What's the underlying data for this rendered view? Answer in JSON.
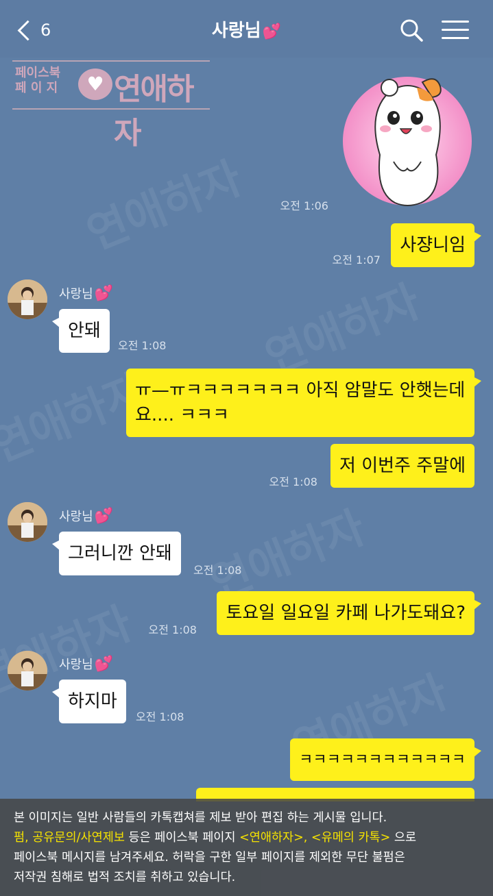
{
  "header": {
    "back_count": "6",
    "title": "사랑님"
  },
  "watermark": {
    "page_label": "페이스북 페이지",
    "page_label_line1": "페이스북",
    "page_label_line2": "페 이 지",
    "name": "연애하자"
  },
  "messages": [
    {
      "side": "mine",
      "type": "emoticon",
      "time": "오전 1:06"
    },
    {
      "side": "mine",
      "text": "사쟝니임",
      "time": "오전 1:07"
    },
    {
      "side": "theirs",
      "sender": "사랑님",
      "text": "안돼",
      "time": "오전 1:08"
    },
    {
      "side": "mine",
      "text": "ㅠ—ㅠㅋㅋㅋㅋㅋㅋㅋ 아직 암말도 안햇는데요.... ㅋㅋㅋ"
    },
    {
      "side": "mine",
      "text": "저 이번주 주말에",
      "time": "오전 1:08"
    },
    {
      "side": "theirs",
      "sender": "사랑님",
      "text": "그러니깐 안돼",
      "time": "오전 1:08"
    },
    {
      "side": "mine",
      "text": "토요일 일요일 카페 나가도돼요?",
      "time": "오전 1:08"
    },
    {
      "side": "theirs",
      "sender": "사랑님",
      "text": "하지마",
      "time": "오전 1:08"
    },
    {
      "side": "mine",
      "text": "ㅋㅋㅋㅋㅋㅋㅋㅋㅋㅋㅋㅋ"
    }
  ],
  "notice": {
    "line1": "본 이미지는 일반 사람들의 카톡캡쳐를 제보 받아 편집 하는 게시물 입니다.",
    "line2_highlight1": "펌, 공유문의/사연제보",
    "line2_text1": " 등은 페이스북 페이지 ",
    "line2_highlight2": "<연애하자>, <유메의 카톡>",
    "line2_text2": " 으로",
    "line3": "페이스북 메시지를 남겨주세요. 허락을 구한 일부 페이지를 제외한 무단 불펌은",
    "line4": "저작권 침해로 법적 조치를 취하고 있습니다."
  },
  "colors": {
    "background": "#5f7fa6",
    "my_bubble": "#fef01b",
    "their_bubble": "#ffffff",
    "heart": "#ff5fb4"
  }
}
